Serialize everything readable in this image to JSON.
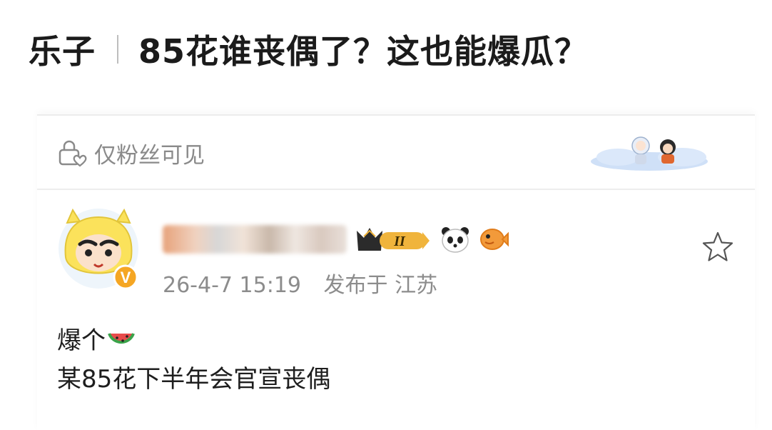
{
  "headline": {
    "source": "乐子",
    "title": "85花谁丧偶了？这也能爆瓜？"
  },
  "card": {
    "visibility": {
      "label": "仅粉丝可见",
      "icon": "lock-heart-icon"
    },
    "decoration_icon": "cloud-characters-sticker",
    "user": {
      "name_blurred": true,
      "avatar_icon": "crayon-shinchan-avatar",
      "verified_badge": "V",
      "rank_badge": "II",
      "stickers": [
        "panda-icon",
        "fish-icon"
      ]
    },
    "meta": {
      "time": "26-4-7 15:19",
      "location": "发布于 江苏"
    },
    "favorite_icon": "star-icon",
    "post": {
      "line1": "爆个",
      "line1_emoji": "watermelon-icon",
      "line2": "某85花下半年会官宣丧偶"
    }
  },
  "colors": {
    "text": "#1e1e1e",
    "meta": "#8c8c8c",
    "gold": "#f0b43c"
  }
}
